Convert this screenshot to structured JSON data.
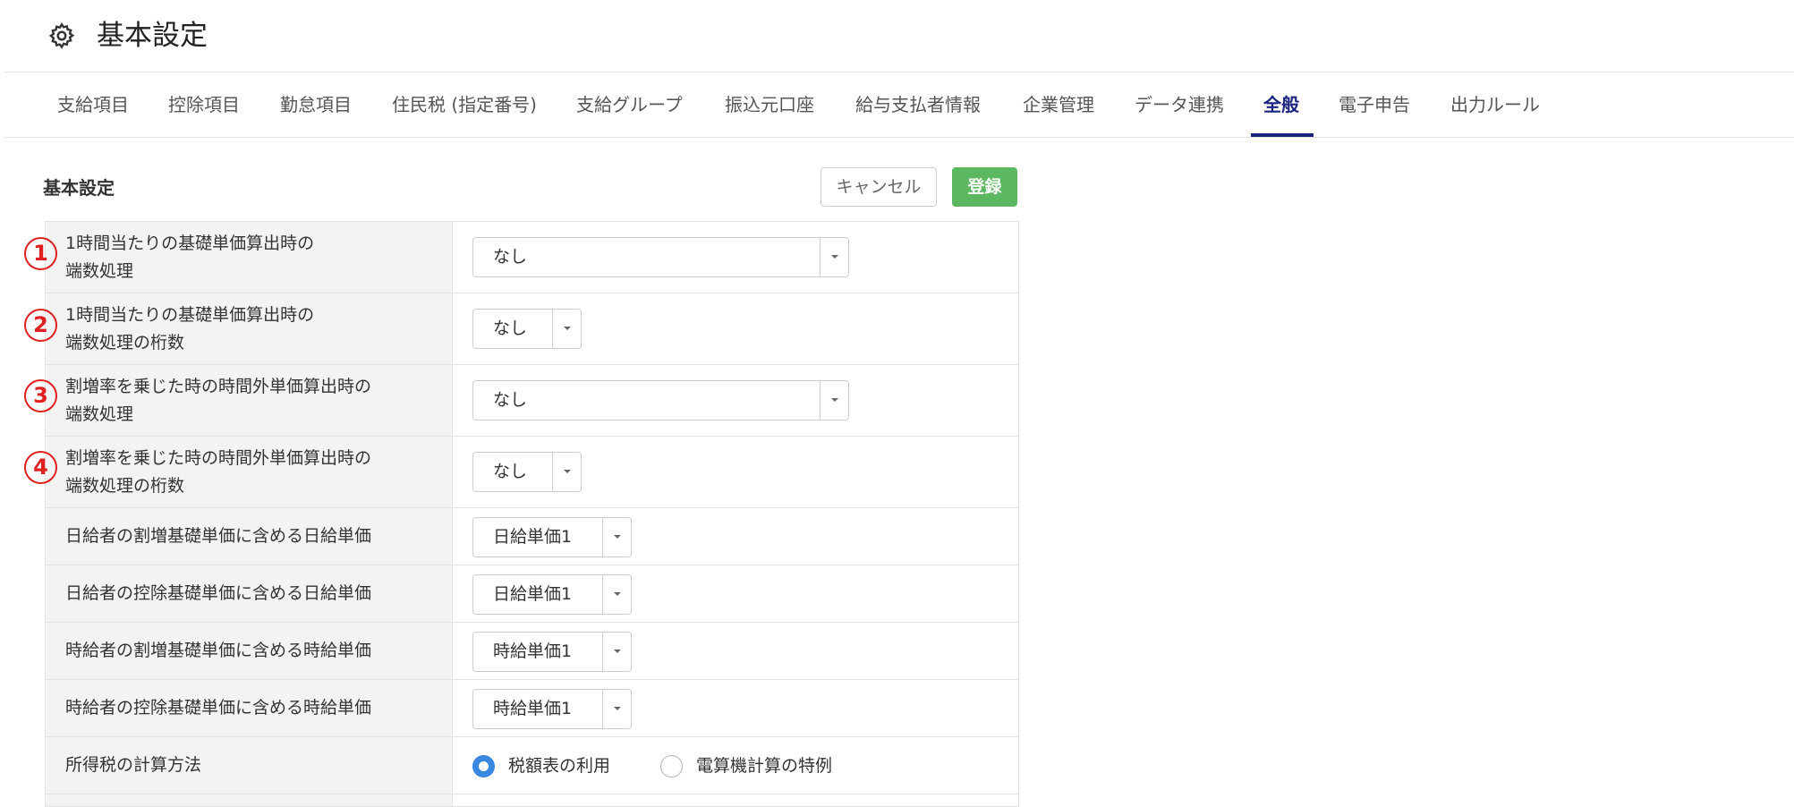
{
  "header": {
    "title": "基本設定",
    "icon": "gear-icon"
  },
  "tabs": [
    {
      "label": "支給項目",
      "active": false
    },
    {
      "label": "控除項目",
      "active": false
    },
    {
      "label": "勤怠項目",
      "active": false
    },
    {
      "label": "住民税 (指定番号)",
      "active": false
    },
    {
      "label": "支給グループ",
      "active": false
    },
    {
      "label": "振込元口座",
      "active": false
    },
    {
      "label": "給与支払者情報",
      "active": false
    },
    {
      "label": "企業管理",
      "active": false
    },
    {
      "label": "データ連携",
      "active": false
    },
    {
      "label": "全般",
      "active": true
    },
    {
      "label": "電子申告",
      "active": false
    },
    {
      "label": "出力ルール",
      "active": false
    }
  ],
  "section": {
    "title": "基本設定",
    "cancel_label": "キャンセル",
    "register_label": "登録"
  },
  "rows": [
    {
      "marker": "1",
      "label_line1": "1時間当たりの基礎単価算出時の",
      "label_line2": "端数処理",
      "value": "なし"
    },
    {
      "marker": "2",
      "label_line1": "1時間当たりの基礎単価算出時の",
      "label_line2": "端数処理の桁数",
      "value": "なし"
    },
    {
      "marker": "3",
      "label_line1": "割増率を乗じた時の時間外単価算出時の",
      "label_line2": "端数処理",
      "value": "なし"
    },
    {
      "marker": "4",
      "label_line1": "割増率を乗じた時の時間外単価算出時の",
      "label_line2": "端数処理の桁数",
      "value": "なし"
    },
    {
      "label": "日給者の割増基礎単価に含める日給単価",
      "value": "日給単価1"
    },
    {
      "label": "日給者の控除基礎単価に含める日給単価",
      "value": "日給単価1"
    },
    {
      "label": "時給者の割増基礎単価に含める時給単価",
      "value": "時給単価1"
    },
    {
      "label": "時給者の控除基礎単価に含める時給単価",
      "value": "時給単価1"
    },
    {
      "label": "所得税の計算方法",
      "options": [
        {
          "label": "税額表の利用",
          "selected": true
        },
        {
          "label": "電算機計算の特例",
          "selected": false
        }
      ]
    }
  ],
  "colors": {
    "accent": "#1a237e",
    "primary_button": "#5cb860",
    "radio": "#3a87e0",
    "marker": "#e02020"
  }
}
